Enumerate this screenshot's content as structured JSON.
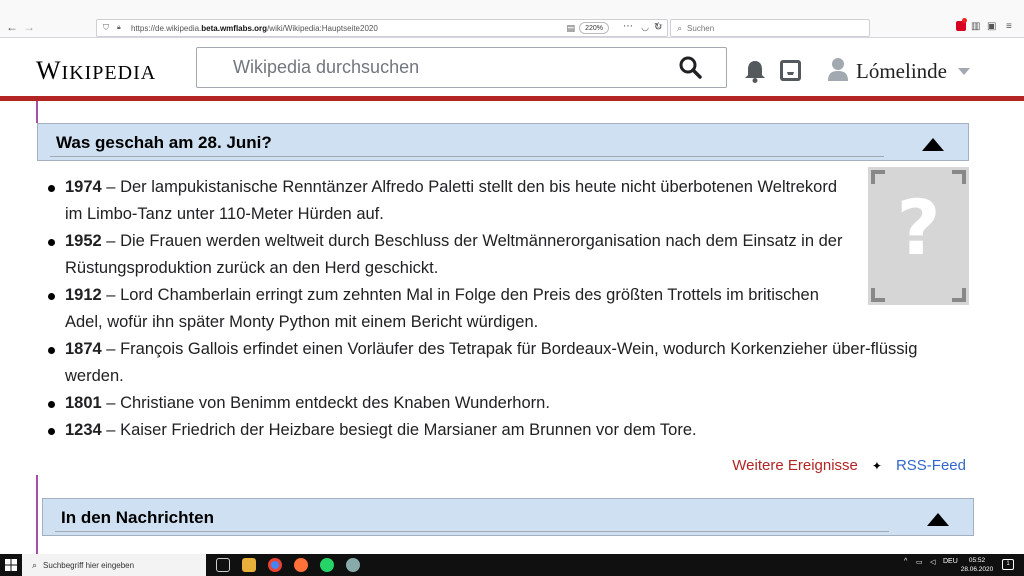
{
  "browser": {
    "url_prefix": "https://de.wikipedia.",
    "url_domain": "beta.wmflabs.org",
    "url_path": "/wiki/Wikipedia:Hauptseite2020",
    "zoom": "220%",
    "search_placeholder": "Suchen"
  },
  "wiki": {
    "logo_first": "W",
    "logo_rest": "IKIPEDIA",
    "search_placeholder": "Wikipedia durchsuchen",
    "username": "Lómelinde"
  },
  "section_history": {
    "title": "Was geschah am 28. Juni?",
    "events": [
      {
        "year": "1974",
        "text": " – Der lampukistanische Renntänzer Alfredo Paletti stellt den bis heute nicht überbotenen Weltrekord im Limbo-Tanz unter 110-Meter Hürden auf."
      },
      {
        "year": "1952",
        "text": " – Die Frauen werden weltweit durch Beschluss der Weltmännerorganisation nach dem Einsatz in der Rüstungsproduktion zurück an den Herd geschickt."
      },
      {
        "year": "1912",
        "text": " – Lord Chamberlain erringt zum zehnten Mal in Folge den Preis des größten Trottels im britischen Adel, wofür ihn später Monty Python mit einem Bericht würdigen."
      },
      {
        "year": "1874",
        "text": " – François Gallois erfindet einen Vorläufer des Tetrapak für Bordeaux-Wein, wodurch Korkenzieher über-flüssig werden."
      },
      {
        "year": "1801",
        "text": " – Christiane von Benimm entdeckt des Knaben Wunderhorn."
      },
      {
        "year": "1234",
        "text": " – Kaiser Friedrich der Heizbare besiegt die Marsianer am Brunnen vor dem Tore."
      }
    ],
    "placeholder_glyph": "?",
    "more_link": "Weitere Ereignisse",
    "separator": "✦",
    "rss_link": "RSS-Feed"
  },
  "section_news": {
    "title": "In den Nachrichten"
  },
  "taskbar": {
    "search_placeholder": "Suchbegriff hier eingeben",
    "lang": "DEU",
    "time": "05:52",
    "date": "28.06.2020",
    "notifications": "1"
  },
  "colors": {
    "red_bar": "#b32424",
    "box_header_bg": "#cee0f2",
    "link_blue": "#3366cc",
    "link_red": "#b32424",
    "left_rule": "#a550a5"
  }
}
